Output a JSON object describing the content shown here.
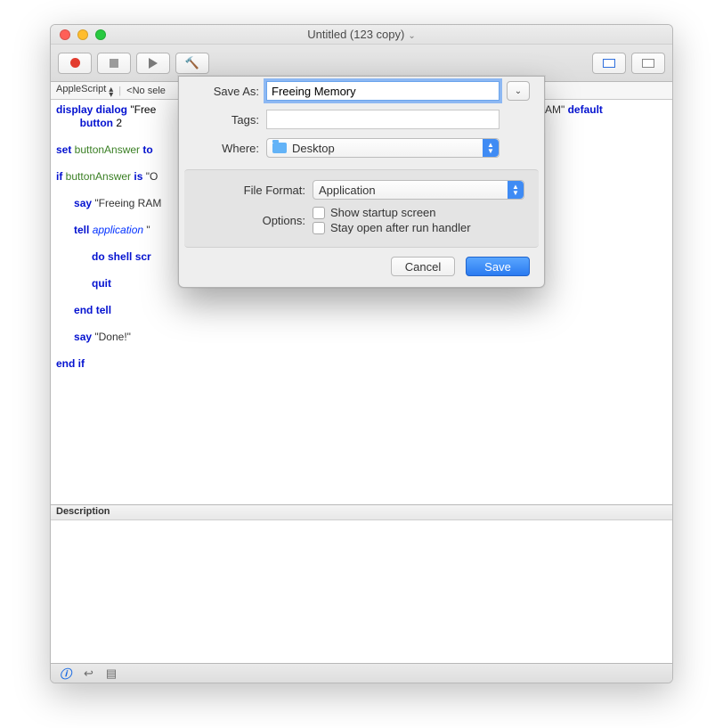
{
  "window": {
    "title": "Untitled (123 copy)"
  },
  "langbar": {
    "language": "AppleScript",
    "selection": "<No sele"
  },
  "code": {
    "l1a": "display dialog",
    "l1b": " \"Free",
    "l1c": "g RAM\" ",
    "l1d": "default",
    "l2a": "button",
    "l2b": " 2",
    "l3a": "set",
    "l3b": " buttonAnswer",
    "l3c": " to ",
    "l4a": "if",
    "l4b": " buttonAnswer",
    "l4c": " is",
    "l4d": " \"O",
    "l5a": "say",
    "l5b": " \"Freeing RAM",
    "l6a": "tell",
    "l6b": " application",
    "l6c": " \"",
    "l7a": "do shell scr",
    "l8a": "quit",
    "l9a": "end",
    "l9b": " tell",
    "l10a": "say",
    "l10b": " \"Done!\"",
    "l11a": "end",
    "l11b": " if"
  },
  "desc": {
    "label": "Description"
  },
  "sheet": {
    "saveas_label": "Save As:",
    "saveas_value": "Freeing Memory",
    "tags_label": "Tags:",
    "tags_value": "",
    "where_label": "Where:",
    "where_value": "Desktop",
    "fileformat_label": "File Format:",
    "fileformat_value": "Application",
    "options_label": "Options:",
    "opt1": "Show startup screen",
    "opt2": "Stay open after run handler",
    "cancel": "Cancel",
    "save": "Save"
  }
}
